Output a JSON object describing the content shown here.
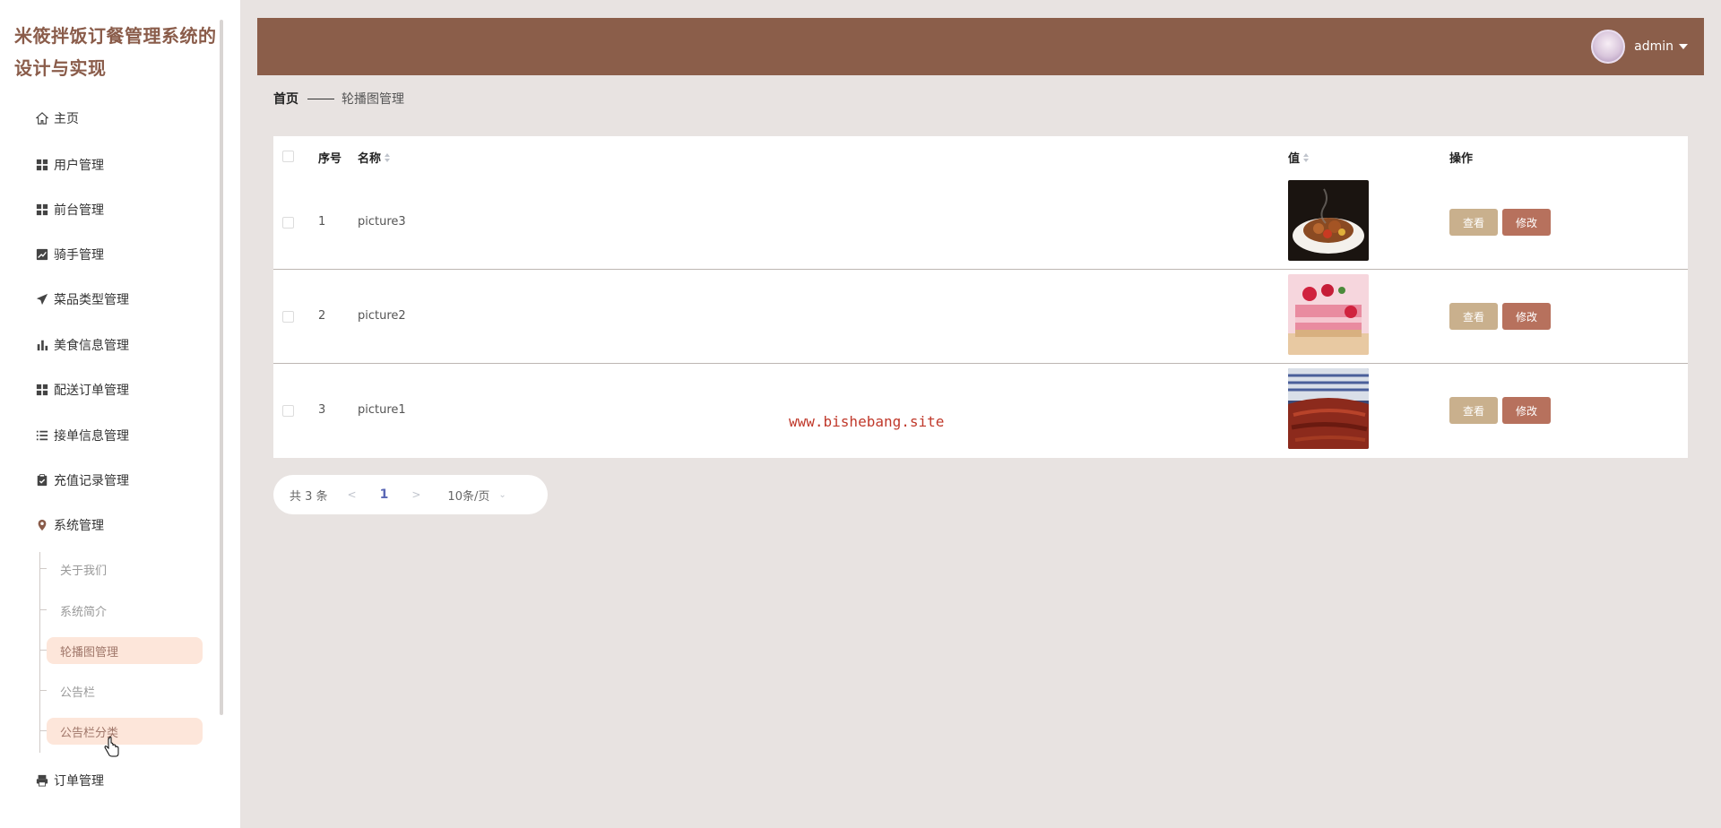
{
  "app": {
    "title": "米筱拌饭订餐管理系统的设计与实现"
  },
  "sidebar": {
    "items": [
      {
        "label": "主页",
        "icon": "home-icon"
      },
      {
        "label": "用户管理",
        "icon": "grid-icon"
      },
      {
        "label": "前台管理",
        "icon": "grid-icon"
      },
      {
        "label": "骑手管理",
        "icon": "chart-line-icon"
      },
      {
        "label": "菜品类型管理",
        "icon": "send-icon"
      },
      {
        "label": "美食信息管理",
        "icon": "bar-chart-icon"
      },
      {
        "label": "配送订单管理",
        "icon": "grid-icon"
      },
      {
        "label": "接单信息管理",
        "icon": "list-icon"
      },
      {
        "label": "充值记录管理",
        "icon": "clipboard-icon"
      },
      {
        "label": "系统管理",
        "icon": "location-icon"
      },
      {
        "label": "订单管理",
        "icon": "printer-icon"
      }
    ],
    "submenu": [
      {
        "label": "关于我们"
      },
      {
        "label": "系统简介"
      },
      {
        "label": "轮播图管理"
      },
      {
        "label": "公告栏"
      },
      {
        "label": "公告栏分类"
      }
    ],
    "active_submenu": "轮播图管理"
  },
  "header": {
    "username": "admin"
  },
  "breadcrumb": {
    "home": "首页",
    "current": "轮播图管理"
  },
  "table": {
    "columns": {
      "index": "序号",
      "name": "名称",
      "value": "值",
      "actions": "操作"
    },
    "rows": [
      {
        "index": "1",
        "name": "picture3",
        "image": "food-dish-image"
      },
      {
        "index": "2",
        "name": "picture2",
        "image": "raspberry-cake-image"
      },
      {
        "index": "3",
        "name": "picture1",
        "image": "grilled-meat-image"
      }
    ],
    "view_label": "查看",
    "edit_label": "修改"
  },
  "watermark": "www.bishebang.site",
  "pagination": {
    "total": "共 3 条",
    "current_page": "1",
    "page_size": "10条/页"
  },
  "colors": {
    "header": "#8b5e4a",
    "accent": "#8a5c4a",
    "view_button": "#c9b08d",
    "edit_button": "#b7715d",
    "active_item": "#fde6da"
  }
}
